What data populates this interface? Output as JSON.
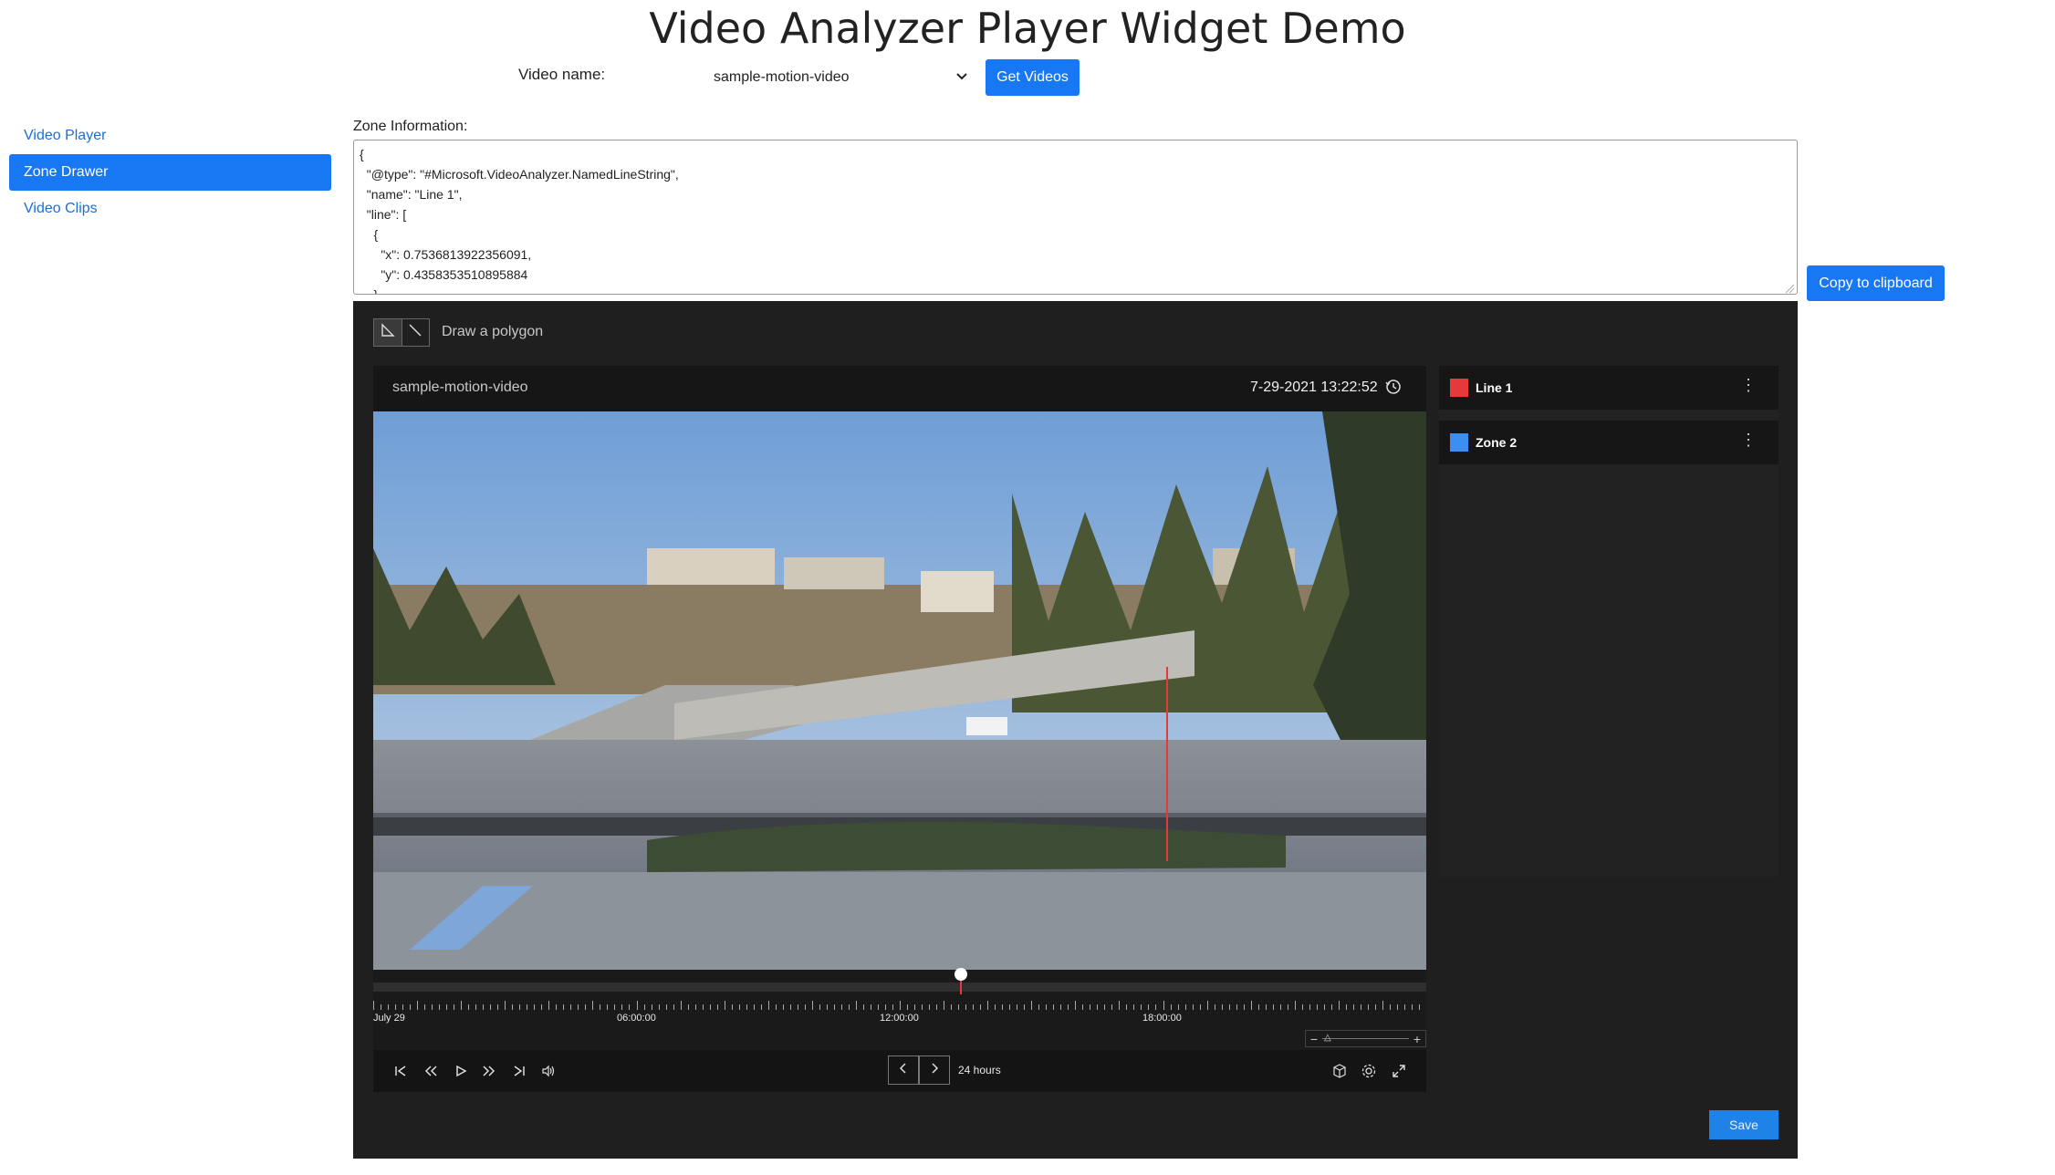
{
  "page": {
    "title": "Video Analyzer Player Widget Demo"
  },
  "toolbar": {
    "video_name_label": "Video name:",
    "video_name_value": "sample-motion-video",
    "get_videos_label": "Get Videos"
  },
  "sidebar": {
    "items": [
      {
        "label": "Video Player",
        "active": false
      },
      {
        "label": "Zone Drawer",
        "active": true
      },
      {
        "label": "Video Clips",
        "active": false
      }
    ]
  },
  "zone_info": {
    "label": "Zone Information:",
    "text": "{\n  \"@type\": \"#Microsoft.VideoAnalyzer.NamedLineString\",\n  \"name\": \"Line 1\",\n  \"line\": [\n    {\n      \"x\": 0.7536813922356091,\n      \"y\": 0.4358353510895884\n    },",
    "copy_label": "Copy to clipboard"
  },
  "drawer": {
    "tools": [
      {
        "icon": "polygon-tool-icon",
        "selected": true
      },
      {
        "icon": "line-tool-icon",
        "selected": false
      }
    ],
    "hint": "Draw a polygon",
    "save_label": "Save"
  },
  "player": {
    "video_title": "sample-motion-video",
    "timestamp": "7-29-2021 13:22:52",
    "timeline": {
      "labels": [
        "July 29",
        "06:00:00",
        "12:00:00",
        "18:00:00"
      ],
      "playhead_fraction": 0.558
    },
    "range_label": "24 hours"
  },
  "zones": [
    {
      "name": "Line 1",
      "color": "#e5393c"
    },
    {
      "name": "Zone 2",
      "color": "#3b8ff0"
    }
  ],
  "colors": {
    "accent": "#1877f2",
    "line_zone": "#e5393c",
    "polygon_zone": "#3b8ff0"
  }
}
